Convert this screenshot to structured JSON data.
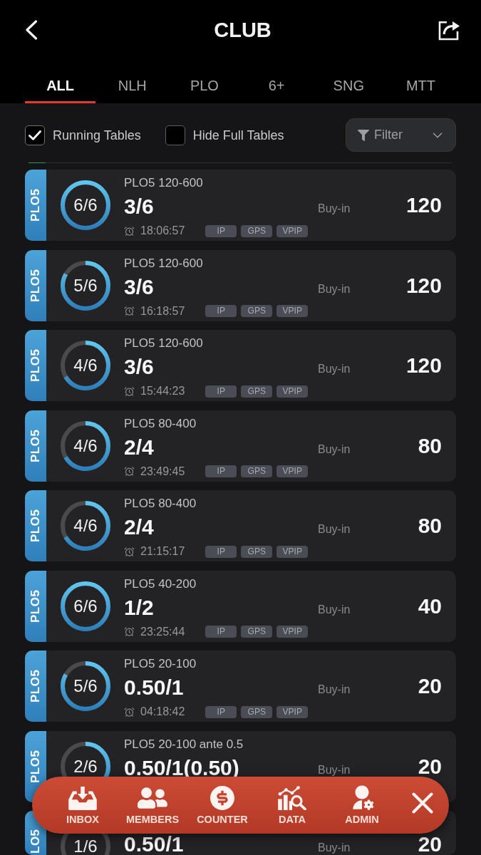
{
  "header": {
    "title": "CLUB"
  },
  "tabs": [
    {
      "label": "ALL",
      "selected": true
    },
    {
      "label": "NLH",
      "selected": false
    },
    {
      "label": "PLO",
      "selected": false
    },
    {
      "label": "6+",
      "selected": false
    },
    {
      "label": "SNG",
      "selected": false
    },
    {
      "label": "MTT",
      "selected": false
    }
  ],
  "filters": {
    "options": [
      {
        "label": "Running Tables",
        "checked": true
      },
      {
        "label": "Hide Full Tables",
        "checked": false
      }
    ],
    "filter_button": {
      "label": "Filter"
    }
  },
  "tables": [
    {
      "kind": "full",
      "game": "PLO5",
      "seats": "6/6",
      "level": 1,
      "name": "PLO5 120-600",
      "blinds": "3/6",
      "timer": "18:06:57",
      "tags": [
        "IP",
        "GPS",
        "VPIP"
      ],
      "buy_in_label": "Buy-in",
      "buy_in": "120"
    },
    {
      "kind": "full",
      "game": "PLO5",
      "seats": "5/6",
      "level": 0.833,
      "name": "PLO5 120-600",
      "blinds": "3/6",
      "timer": "16:18:57",
      "tags": [
        "IP",
        "GPS",
        "VPIP"
      ],
      "buy_in_label": "Buy-in",
      "buy_in": "120"
    },
    {
      "kind": "full",
      "game": "PLO5",
      "seats": "4/6",
      "level": 0.667,
      "name": "PLO5 120-600",
      "blinds": "3/6",
      "timer": "15:44:23",
      "tags": [
        "IP",
        "GPS",
        "VPIP"
      ],
      "buy_in_label": "Buy-in",
      "buy_in": "120"
    },
    {
      "kind": "full",
      "game": "PLO5",
      "seats": "4/6",
      "level": 0.667,
      "name": "PLO5 80-400",
      "blinds": "2/4",
      "timer": "23:49:45",
      "tags": [
        "IP",
        "GPS",
        "VPIP"
      ],
      "buy_in_label": "Buy-in",
      "buy_in": "80"
    },
    {
      "kind": "full",
      "game": "PLO5",
      "seats": "4/6",
      "level": 0.667,
      "name": "PLO5 80-400",
      "blinds": "2/4",
      "timer": "21:15:17",
      "tags": [
        "IP",
        "GPS",
        "VPIP"
      ],
      "buy_in_label": "Buy-in",
      "buy_in": "80"
    },
    {
      "kind": "full",
      "game": "PLO5",
      "seats": "6/6",
      "level": 1,
      "name": "PLO5 40-200",
      "blinds": "1/2",
      "timer": "23:25:44",
      "tags": [
        "IP",
        "GPS",
        "VPIP"
      ],
      "buy_in_label": "Buy-in",
      "buy_in": "40"
    },
    {
      "kind": "full",
      "game": "PLO5",
      "seats": "5/6",
      "level": 0.833,
      "name": "PLO5 20-100",
      "blinds": "0.50/1",
      "timer": "04:18:42",
      "tags": [
        "IP",
        "GPS",
        "VPIP"
      ],
      "buy_in_label": "Buy-in",
      "buy_in": "20"
    },
    {
      "kind": "full",
      "game": "PLO5",
      "seats": "2/6",
      "level": 0.333,
      "name": "PLO5 20-100 ante 0.5",
      "blinds": "0.50/1(0.50)",
      "buy_in_label": "Buy-in",
      "buy_in": "20"
    },
    {
      "kind": "partial",
      "game": "LO5",
      "seats": "1/6",
      "blinds": "0.50/1",
      "buy_in_label": "Buy-in",
      "buy_in": "20"
    }
  ],
  "toolbar": {
    "items": [
      {
        "kind": "inbox",
        "label": "INBOX"
      },
      {
        "kind": "members",
        "label": "MEMBERS"
      },
      {
        "kind": "counter",
        "label": "COUNTER"
      },
      {
        "kind": "data",
        "label": "DATA"
      },
      {
        "kind": "admin",
        "label": "ADMIN"
      }
    ]
  }
}
